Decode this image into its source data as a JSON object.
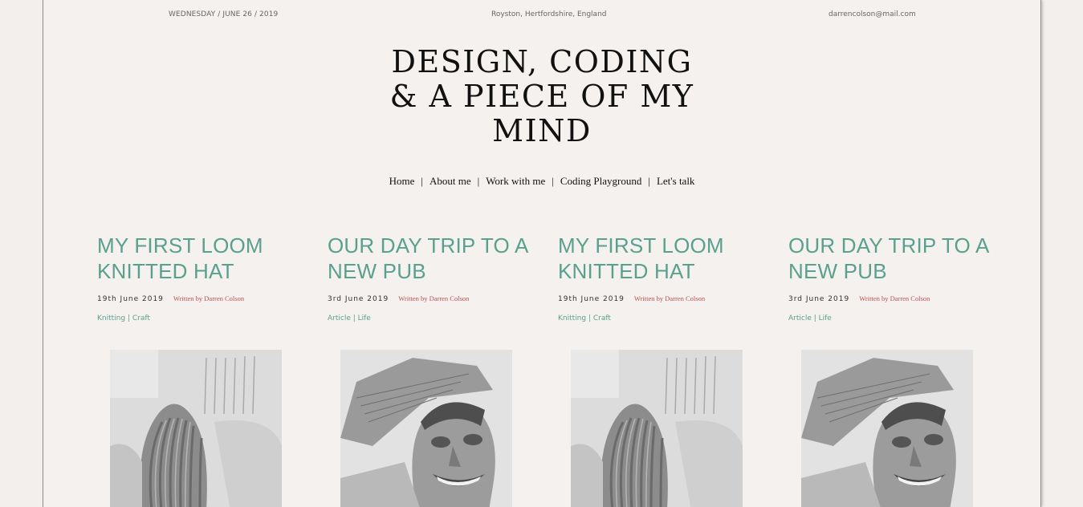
{
  "topbar": {
    "date": "WEDNESDAY / JUNE 26 / 2019",
    "location": "Royston, Hertfordshire, England",
    "email": "darrencolson@mail.com"
  },
  "site_title": {
    "line1": "DESIGN, CODING",
    "line2": "& A PIECE OF MY",
    "line3": "MIND"
  },
  "nav": {
    "items": [
      {
        "label": "Home"
      },
      {
        "label": "About me"
      },
      {
        "label": "Work with me"
      },
      {
        "label": "Coding Playground"
      },
      {
        "label": "Let's talk"
      }
    ],
    "separator": "|"
  },
  "posts": [
    {
      "title": "MY FIRST LOOM KNITTED HAT",
      "date": "19th June 2019",
      "author": "Written by Darren Colson",
      "categories": "Knitting | Craft",
      "image": "knitted-hat-photo"
    },
    {
      "title": "OUR DAY TRIP TO A NEW PUB",
      "date": "3rd June 2019",
      "author": "Written by Darren Colson",
      "categories": "Article | Life",
      "image": "selfie-photo"
    },
    {
      "title": "MY FIRST LOOM KNITTED HAT",
      "date": "19th June 2019",
      "author": "Written by Darren Colson",
      "categories": "Knitting | Craft",
      "image": "knitted-hat-photo"
    },
    {
      "title": "OUR DAY TRIP TO A NEW PUB",
      "date": "3rd June 2019",
      "author": "Written by Darren Colson",
      "categories": "Article | Life",
      "image": "selfie-photo"
    }
  ],
  "colors": {
    "accent": "#5aa08f",
    "author": "#c0504d",
    "background": "#f4f1ee"
  }
}
